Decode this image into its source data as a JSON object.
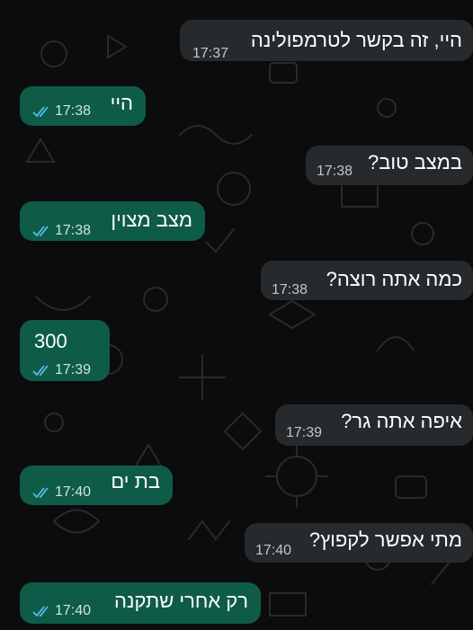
{
  "colors": {
    "background": "#0c0c0c",
    "incoming_bubble": "#272a2c",
    "outgoing_bubble": "#0e5c47",
    "read_ticks": "#53bdeb"
  },
  "icons": {
    "read_receipt": "double-check-icon"
  },
  "messages": [
    {
      "direction": "incoming",
      "text": "היי, זה בקשר לטרמפולינה",
      "time": "17:37"
    },
    {
      "direction": "outgoing",
      "text": "היי",
      "time": "17:38",
      "status": "read"
    },
    {
      "direction": "incoming",
      "text": "במצב טוב?",
      "time": "17:38"
    },
    {
      "direction": "outgoing",
      "text": "מצב מצוין",
      "time": "17:38",
      "status": "read"
    },
    {
      "direction": "incoming",
      "text": "כמה אתה רוצה?",
      "time": "17:38"
    },
    {
      "direction": "outgoing",
      "text": "300",
      "time": "17:39",
      "status": "read"
    },
    {
      "direction": "incoming",
      "text": "איפה אתה גר?",
      "time": "17:39"
    },
    {
      "direction": "outgoing",
      "text": "בת ים",
      "time": "17:40",
      "status": "read"
    },
    {
      "direction": "incoming",
      "text": "מתי אפשר לקפוץ?",
      "time": "17:40"
    },
    {
      "direction": "outgoing",
      "text": "רק אחרי שתקנה",
      "time": "17:40",
      "status": "read"
    }
  ]
}
